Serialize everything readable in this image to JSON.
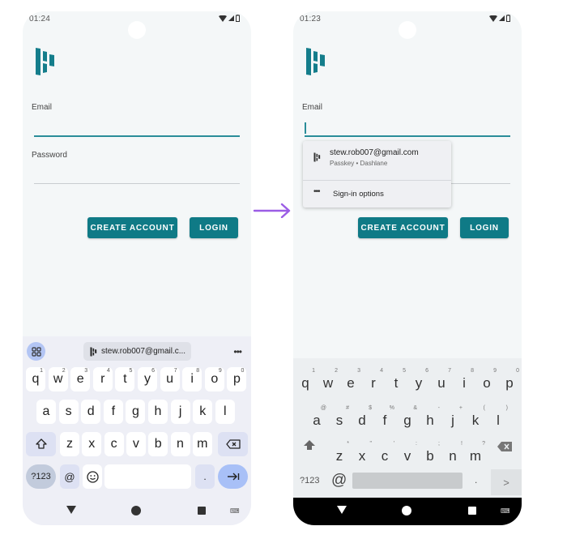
{
  "left_screen": {
    "status_bar": {
      "time": "01:24"
    },
    "form": {
      "email_label": "Email",
      "email_value": "",
      "password_label": "Password",
      "password_value": "",
      "create_account_label": "CREATE ACCOUNT",
      "login_label": "LOGIN"
    },
    "keyboard": {
      "suggestion_chip": "stew.rob007@gmail.c...",
      "more_label": "•••",
      "row1": [
        {
          "k": "q",
          "h": "1"
        },
        {
          "k": "w",
          "h": "2"
        },
        {
          "k": "e",
          "h": "3"
        },
        {
          "k": "r",
          "h": "4"
        },
        {
          "k": "t",
          "h": "5"
        },
        {
          "k": "y",
          "h": "6"
        },
        {
          "k": "u",
          "h": "7"
        },
        {
          "k": "i",
          "h": "8"
        },
        {
          "k": "o",
          "h": "9"
        },
        {
          "k": "p",
          "h": "0"
        }
      ],
      "row2": [
        "a",
        "s",
        "d",
        "f",
        "g",
        "h",
        "j",
        "k",
        "l"
      ],
      "row3": [
        "z",
        "x",
        "c",
        "v",
        "b",
        "n",
        "m"
      ],
      "symbols_label": "?123",
      "at_label": "@",
      "period_label": ".",
      "shift_icon": "shift-icon",
      "backspace_icon": "backspace-icon",
      "emoji_icon": "emoji-icon",
      "enter_icon": "tab-next-icon"
    }
  },
  "right_screen": {
    "status_bar": {
      "time": "01:23"
    },
    "form": {
      "email_label": "Email",
      "email_value": "",
      "create_account_label": "CREATE ACCOUNT",
      "login_label": "LOGIN"
    },
    "autofill_popup": {
      "account_email": "stew.rob007@gmail.com",
      "account_subtitle": "Passkey • Dashlane",
      "options_dots": "•••",
      "options_label": "Sign-in options"
    },
    "keyboard": {
      "row1": [
        {
          "k": "q",
          "h": "1"
        },
        {
          "k": "w",
          "h": "2"
        },
        {
          "k": "e",
          "h": "3"
        },
        {
          "k": "r",
          "h": "4"
        },
        {
          "k": "t",
          "h": "5"
        },
        {
          "k": "y",
          "h": "6"
        },
        {
          "k": "u",
          "h": "7"
        },
        {
          "k": "i",
          "h": "8"
        },
        {
          "k": "o",
          "h": "9"
        },
        {
          "k": "p",
          "h": "0"
        }
      ],
      "row2": [
        {
          "k": "a",
          "h": "@"
        },
        {
          "k": "s",
          "h": "#"
        },
        {
          "k": "d",
          "h": "$"
        },
        {
          "k": "f",
          "h": "%"
        },
        {
          "k": "g",
          "h": "&"
        },
        {
          "k": "h",
          "h": "-"
        },
        {
          "k": "j",
          "h": "+"
        },
        {
          "k": "k",
          "h": "("
        },
        {
          "k": "l",
          "h": ")"
        }
      ],
      "row3": [
        {
          "k": "z",
          "h": "*"
        },
        {
          "k": "x",
          "h": "\""
        },
        {
          "k": "c",
          "h": "'"
        },
        {
          "k": "v",
          "h": ":"
        },
        {
          "k": "b",
          "h": ";"
        },
        {
          "k": "n",
          "h": "!"
        },
        {
          "k": "m",
          "h": "?"
        }
      ],
      "symbols_label": "?123",
      "at_label": "@",
      "period_label": ".",
      "next_label": ">"
    }
  },
  "colors": {
    "brand_teal": "#0f7a86",
    "arrow_purple": "#9b5de5",
    "enter_key_blue": "#a8c0f7"
  }
}
